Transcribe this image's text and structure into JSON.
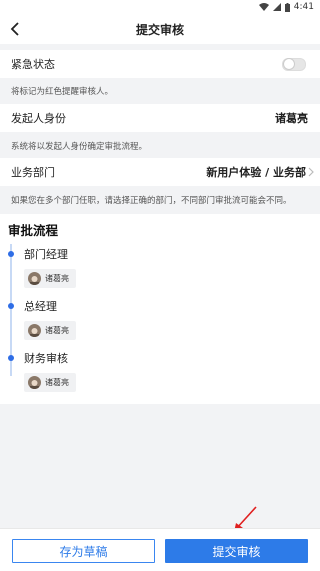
{
  "status": {
    "time": "4:41"
  },
  "nav": {
    "title": "提交审核"
  },
  "urgent": {
    "label": "紧急状态",
    "hint": "将标记为红色提醒审核人。",
    "on": false
  },
  "initiator": {
    "label": "发起人身份",
    "value": "诸葛亮",
    "hint": "系统将以发起人身份确定审批流程。"
  },
  "department": {
    "label": "业务部门",
    "value": "新用户体验 / 业务部",
    "hint": "如果您在多个部门任职，请选择正确的部门，不同部门审批流可能会不同。"
  },
  "flow": {
    "title": "审批流程",
    "steps": [
      {
        "title": "部门经理",
        "approver": "诸葛亮"
      },
      {
        "title": "总经理",
        "approver": "诸葛亮"
      },
      {
        "title": "财务审核",
        "approver": "诸葛亮"
      }
    ]
  },
  "actions": {
    "draft": "存为草稿",
    "submit": "提交审核"
  },
  "colors": {
    "accent": "#2d7be8",
    "annotation": "#e02020"
  }
}
